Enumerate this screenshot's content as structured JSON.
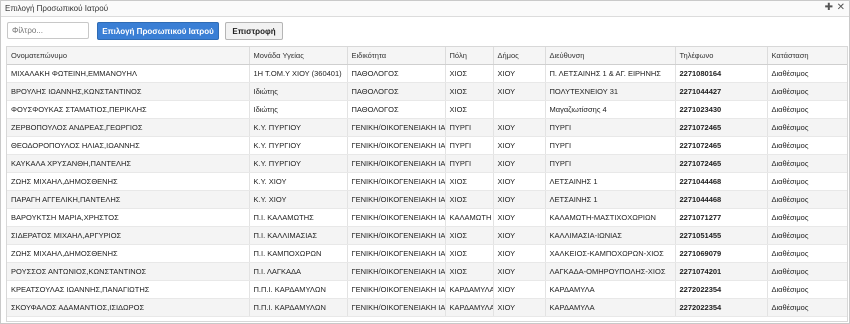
{
  "window": {
    "title": "Επιλογή Προσωπικού Ιατρού",
    "pin_glyph": "✚",
    "close_glyph": "✕"
  },
  "toolbar": {
    "filter_placeholder": "Φίλτρο...",
    "select_label": "Επιλογή Προσωπικού Ιατρού",
    "back_label": "Επιστροφή",
    "accent_color": "#3a7fd5"
  },
  "table": {
    "columns": [
      "Ονοματεπώνυμο",
      "Μονάδα Υγείας",
      "Ειδικότητα",
      "Πόλη",
      "Δήμος",
      "Διεύθυνση",
      "Τηλέφωνο",
      "Κατάσταση"
    ],
    "rows": [
      [
        "ΜΙΧΑΛΑΚΗ ΦΩΤΕΙΝΗ,ΕΜΜΑΝΟΥΗΛ",
        "1Η Τ.ΟΜ.Υ ΧΙΟΥ (360401)",
        "ΠΑΘΟΛΟΓΟΣ",
        "ΧΙΟΣ",
        "ΧΙΟΥ",
        "Π. ΛΕΤΣΑΙΝΗΣ 1 & ΑΓ. ΕΙΡΗΝΗΣ",
        "2271080164",
        "Διαθέσιμος"
      ],
      [
        "ΒΡΟΥΛΗΣ ΙΩΑΝΝΗΣ,ΚΩΝΣΤΑΝΤΙΝΟΣ",
        "Ιδιώτης",
        "ΠΑΘΟΛΟΓΟΣ",
        "ΧΙΟΣ",
        "ΧΙΟΥ",
        "ΠΟΛΥΤΕΧΝΕΙΟΥ 31",
        "2271044427",
        "Διαθέσιμος"
      ],
      [
        "ΦΟΥΣΦΟΥΚΑΣ ΣΤΑΜΑΤΙΟΣ,ΠΕΡΙΚΛΗΣ",
        "Ιδιώτης",
        "ΠΑΘΟΛΟΓΟΣ",
        "ΧΙΟΣ",
        "",
        "Μαγαζιωτίσσης 4",
        "2271023430",
        "Διαθέσιμος"
      ],
      [
        "ΖΕΡΒΟΠΟΥΛΟΣ ΑΝΔΡΕΑΣ,ΓΕΩΡΓΙΟΣ",
        "Κ.Υ. ΠΥΡΓΙΟΥ",
        "ΓΕΝΙΚΗ/ΟΙΚΟΓΕΝΕΙΑΚΗ ΙΑΤΡΙΚΗ",
        "ΠΥΡΓΙ",
        "ΧΙΟΥ",
        "ΠΥΡΓΙ",
        "2271072465",
        "Διαθέσιμος"
      ],
      [
        "ΘΕΟΔΟΡΟΠΟΥΛΟΣ ΗΛΙΑΣ,ΙΩΑΝΝΗΣ",
        "Κ.Υ. ΠΥΡΓΙΟΥ",
        "ΓΕΝΙΚΗ/ΟΙΚΟΓΕΝΕΙΑΚΗ ΙΑΤΡΙΚΗ",
        "ΠΥΡΓΙ",
        "ΧΙΟΥ",
        "ΠΥΡΓΙ",
        "2271072465",
        "Διαθέσιμος"
      ],
      [
        "ΚΑΥΚΑΛΑ ΧΡΥΣΑΝΘΗ,ΠΑΝΤΕΛΗΣ",
        "Κ.Υ. ΠΥΡΓΙΟΥ",
        "ΓΕΝΙΚΗ/ΟΙΚΟΓΕΝΕΙΑΚΗ ΙΑΤΡΙΚΗ",
        "ΠΥΡΓΙ",
        "ΧΙΟΥ",
        "ΠΥΡΓΙ",
        "2271072465",
        "Διαθέσιμος"
      ],
      [
        "ΖΩΗΣ ΜΙΧΑΗΛ,ΔΗΜΟΣΘΕΝΗΣ",
        "Κ.Υ. ΧΙΟΥ",
        "ΓΕΝΙΚΗ/ΟΙΚΟΓΕΝΕΙΑΚΗ ΙΑΤΡΙΚΗ",
        "ΧΙΟΣ",
        "ΧΙΟΥ",
        "ΛΕΤΣΑΙΝΗΣ 1",
        "2271044468",
        "Διαθέσιμος"
      ],
      [
        "ΠΑΡΑΓΗ ΑΓΓΕΛΙΚΗ,ΠΑΝΤΕΛΗΣ",
        "Κ.Υ. ΧΙΟΥ",
        "ΓΕΝΙΚΗ/ΟΙΚΟΓΕΝΕΙΑΚΗ ΙΑΤΡΙΚΗ",
        "ΧΙΟΣ",
        "ΧΙΟΥ",
        "ΛΕΤΣΑΙΝΗΣ 1",
        "2271044468",
        "Διαθέσιμος"
      ],
      [
        "ΒΑΡΟΥΚΤΣΗ ΜΑΡΙΑ,ΧΡΗΣΤΟΣ",
        "Π.Ι. ΚΑΛΑΜΩΤΗΣ",
        "ΓΕΝΙΚΗ/ΟΙΚΟΓΕΝΕΙΑΚΗ ΙΑΤΡΙΚΗ",
        "ΚΑΛΑΜΩΤΗ",
        "ΧΙΟΥ",
        "ΚΑΛΑΜΩΤΗ-ΜΑΣΤΙΧΟΧΩΡΙΩΝ",
        "2271071277",
        "Διαθέσιμος"
      ],
      [
        "ΣΙΔΕΡΑΤΟΣ ΜΙΧΑΗΛ,ΑΡΓΥΡΙΟΣ",
        "Π.Ι. ΚΑΛΛΙΜΑΣΙΑΣ",
        "ΓΕΝΙΚΗ/ΟΙΚΟΓΕΝΕΙΑΚΗ ΙΑΤΡΙΚΗ",
        "ΧΙΟΣ",
        "ΧΙΟΥ",
        "ΚΑΛΛΙΜΑΣΙΑ-ΙΩΝΙΑΣ",
        "2271051455",
        "Διαθέσιμος"
      ],
      [
        "ΖΩΗΣ ΜΙΧΑΗΛ,ΔΗΜΟΣΘΕΝΗΣ",
        "Π.Ι. ΚΑΜΠΟΧΩΡΩΝ",
        "ΓΕΝΙΚΗ/ΟΙΚΟΓΕΝΕΙΑΚΗ ΙΑΤΡΙΚΗ",
        "ΧΙΟΣ",
        "ΧΙΟΥ",
        "ΧΑΛΚΕΙΟΣ-ΚΑΜΠΟΧΩΡΩΝ-ΧΙΟΣ",
        "2271069079",
        "Διαθέσιμος"
      ],
      [
        "ΡΟΥΣΣΟΣ ΑΝΤΩΝΙΟΣ,ΚΩΝΣΤΑΝΤΙΝΟΣ",
        "Π.Ι. ΛΑΓΚΑΔΑ",
        "ΓΕΝΙΚΗ/ΟΙΚΟΓΕΝΕΙΑΚΗ ΙΑΤΡΙΚΗ",
        "ΧΙΟΣ",
        "ΧΙΟΥ",
        "ΛΑΓΚΑΔΑ-ΟΜΗΡΟΥΠΟΛΗΣ-ΧΙΟΣ",
        "2271074201",
        "Διαθέσιμος"
      ],
      [
        "ΚΡΕΑΤΣΟΥΛΑΣ ΙΩΑΝΝΗΣ,ΠΑΝΑΓΙΩΤΗΣ",
        "Π.Π.Ι. ΚΑΡΔΑΜΥΛΩΝ",
        "ΓΕΝΙΚΗ/ΟΙΚΟΓΕΝΕΙΑΚΗ ΙΑΤΡΙΚΗ",
        "ΚΑΡΔΑΜΥΛΑ",
        "ΧΙΟΥ",
        "ΚΑΡΔΑΜΥΛΑ",
        "2272022354",
        "Διαθέσιμος"
      ],
      [
        "ΣΚΟΥΦΑΛΟΣ ΑΔΑΜΑΝΤΙΟΣ,ΙΣΙΔΩΡΟΣ",
        "Π.Π.Ι. ΚΑΡΔΑΜΥΛΩΝ",
        "ΓΕΝΙΚΗ/ΟΙΚΟΓΕΝΕΙΑΚΗ ΙΑΤΡΙΚΗ",
        "ΚΑΡΔΑΜΥΛΑ",
        "ΧΙΟΥ",
        "ΚΑΡΔΑΜΥΛΑ",
        "2272022354",
        "Διαθέσιμος"
      ]
    ]
  }
}
